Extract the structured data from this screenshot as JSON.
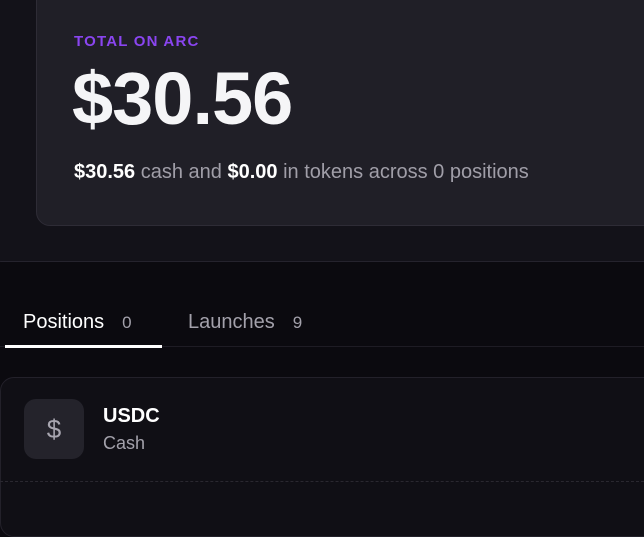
{
  "total": {
    "label": "TOTAL ON ARC",
    "amount": "$30.56",
    "summary": {
      "cash": "$30.56",
      "text1": " cash and ",
      "tokens": "$0.00",
      "text2": " in tokens across 0 positions"
    }
  },
  "tabs": [
    {
      "label": "Positions",
      "count": "0",
      "active": true
    },
    {
      "label": "Launches",
      "count": "9",
      "active": false
    }
  ],
  "assets": [
    {
      "icon": "dollar-icon",
      "symbol": "$",
      "name": "USDC",
      "sub": "Cash"
    }
  ],
  "colors": {
    "accent": "#8a45f0",
    "background": "#0b0a0f",
    "card": "#201f27"
  }
}
